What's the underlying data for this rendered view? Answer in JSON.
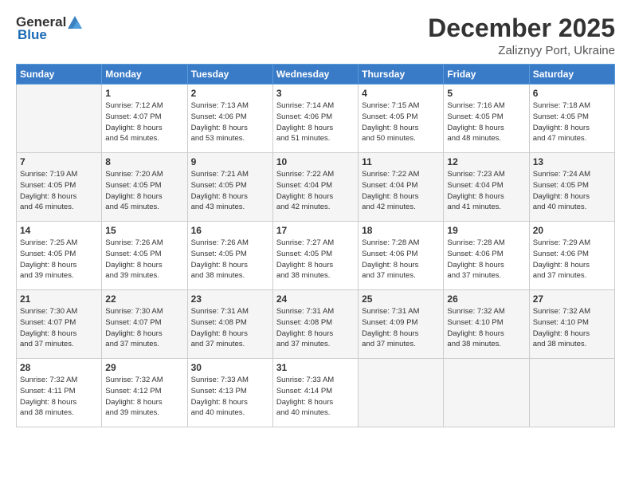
{
  "header": {
    "logo_general": "General",
    "logo_blue": "Blue",
    "month_title": "December 2025",
    "location": "Zaliznyy Port, Ukraine"
  },
  "days_of_week": [
    "Sunday",
    "Monday",
    "Tuesday",
    "Wednesday",
    "Thursday",
    "Friday",
    "Saturday"
  ],
  "weeks": [
    [
      {
        "day": "",
        "info": ""
      },
      {
        "day": "1",
        "info": "Sunrise: 7:12 AM\nSunset: 4:07 PM\nDaylight: 8 hours\nand 54 minutes."
      },
      {
        "day": "2",
        "info": "Sunrise: 7:13 AM\nSunset: 4:06 PM\nDaylight: 8 hours\nand 53 minutes."
      },
      {
        "day": "3",
        "info": "Sunrise: 7:14 AM\nSunset: 4:06 PM\nDaylight: 8 hours\nand 51 minutes."
      },
      {
        "day": "4",
        "info": "Sunrise: 7:15 AM\nSunset: 4:05 PM\nDaylight: 8 hours\nand 50 minutes."
      },
      {
        "day": "5",
        "info": "Sunrise: 7:16 AM\nSunset: 4:05 PM\nDaylight: 8 hours\nand 48 minutes."
      },
      {
        "day": "6",
        "info": "Sunrise: 7:18 AM\nSunset: 4:05 PM\nDaylight: 8 hours\nand 47 minutes."
      }
    ],
    [
      {
        "day": "7",
        "info": "Sunrise: 7:19 AM\nSunset: 4:05 PM\nDaylight: 8 hours\nand 46 minutes."
      },
      {
        "day": "8",
        "info": "Sunrise: 7:20 AM\nSunset: 4:05 PM\nDaylight: 8 hours\nand 45 minutes."
      },
      {
        "day": "9",
        "info": "Sunrise: 7:21 AM\nSunset: 4:05 PM\nDaylight: 8 hours\nand 43 minutes."
      },
      {
        "day": "10",
        "info": "Sunrise: 7:22 AM\nSunset: 4:04 PM\nDaylight: 8 hours\nand 42 minutes."
      },
      {
        "day": "11",
        "info": "Sunrise: 7:22 AM\nSunset: 4:04 PM\nDaylight: 8 hours\nand 42 minutes."
      },
      {
        "day": "12",
        "info": "Sunrise: 7:23 AM\nSunset: 4:04 PM\nDaylight: 8 hours\nand 41 minutes."
      },
      {
        "day": "13",
        "info": "Sunrise: 7:24 AM\nSunset: 4:05 PM\nDaylight: 8 hours\nand 40 minutes."
      }
    ],
    [
      {
        "day": "14",
        "info": "Sunrise: 7:25 AM\nSunset: 4:05 PM\nDaylight: 8 hours\nand 39 minutes."
      },
      {
        "day": "15",
        "info": "Sunrise: 7:26 AM\nSunset: 4:05 PM\nDaylight: 8 hours\nand 39 minutes."
      },
      {
        "day": "16",
        "info": "Sunrise: 7:26 AM\nSunset: 4:05 PM\nDaylight: 8 hours\nand 38 minutes."
      },
      {
        "day": "17",
        "info": "Sunrise: 7:27 AM\nSunset: 4:05 PM\nDaylight: 8 hours\nand 38 minutes."
      },
      {
        "day": "18",
        "info": "Sunrise: 7:28 AM\nSunset: 4:06 PM\nDaylight: 8 hours\nand 37 minutes."
      },
      {
        "day": "19",
        "info": "Sunrise: 7:28 AM\nSunset: 4:06 PM\nDaylight: 8 hours\nand 37 minutes."
      },
      {
        "day": "20",
        "info": "Sunrise: 7:29 AM\nSunset: 4:06 PM\nDaylight: 8 hours\nand 37 minutes."
      }
    ],
    [
      {
        "day": "21",
        "info": "Sunrise: 7:30 AM\nSunset: 4:07 PM\nDaylight: 8 hours\nand 37 minutes."
      },
      {
        "day": "22",
        "info": "Sunrise: 7:30 AM\nSunset: 4:07 PM\nDaylight: 8 hours\nand 37 minutes."
      },
      {
        "day": "23",
        "info": "Sunrise: 7:31 AM\nSunset: 4:08 PM\nDaylight: 8 hours\nand 37 minutes."
      },
      {
        "day": "24",
        "info": "Sunrise: 7:31 AM\nSunset: 4:08 PM\nDaylight: 8 hours\nand 37 minutes."
      },
      {
        "day": "25",
        "info": "Sunrise: 7:31 AM\nSunset: 4:09 PM\nDaylight: 8 hours\nand 37 minutes."
      },
      {
        "day": "26",
        "info": "Sunrise: 7:32 AM\nSunset: 4:10 PM\nDaylight: 8 hours\nand 38 minutes."
      },
      {
        "day": "27",
        "info": "Sunrise: 7:32 AM\nSunset: 4:10 PM\nDaylight: 8 hours\nand 38 minutes."
      }
    ],
    [
      {
        "day": "28",
        "info": "Sunrise: 7:32 AM\nSunset: 4:11 PM\nDaylight: 8 hours\nand 38 minutes."
      },
      {
        "day": "29",
        "info": "Sunrise: 7:32 AM\nSunset: 4:12 PM\nDaylight: 8 hours\nand 39 minutes."
      },
      {
        "day": "30",
        "info": "Sunrise: 7:33 AM\nSunset: 4:13 PM\nDaylight: 8 hours\nand 40 minutes."
      },
      {
        "day": "31",
        "info": "Sunrise: 7:33 AM\nSunset: 4:14 PM\nDaylight: 8 hours\nand 40 minutes."
      },
      {
        "day": "",
        "info": ""
      },
      {
        "day": "",
        "info": ""
      },
      {
        "day": "",
        "info": ""
      }
    ]
  ]
}
